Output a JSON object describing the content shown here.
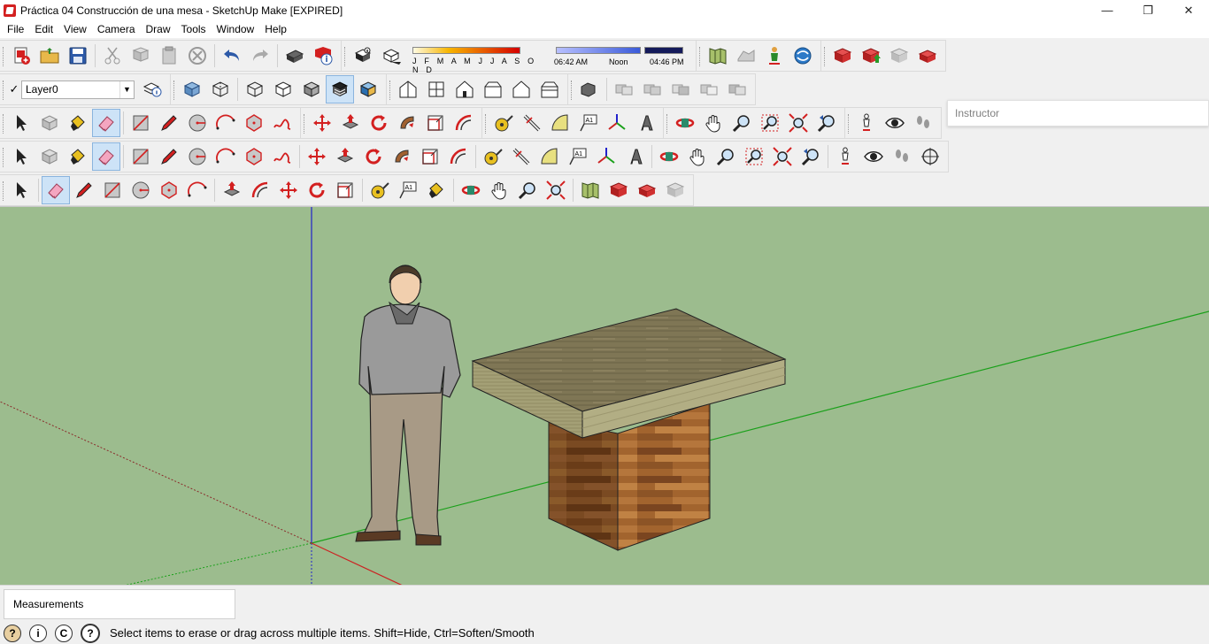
{
  "window": {
    "title": "Práctica 04 Construcción de una mesa - SketchUp Make [EXPIRED]",
    "minimize": "—",
    "restore": "❐",
    "close": "✕"
  },
  "menu": {
    "items": [
      "File",
      "Edit",
      "View",
      "Camera",
      "Draw",
      "Tools",
      "Window",
      "Help"
    ]
  },
  "shadows": {
    "months": "J F M A M J J A S O N D",
    "time_start": "06:42 AM",
    "time_mid": "Noon",
    "time_end": "04:46 PM"
  },
  "layers": {
    "current": "Layer0",
    "check": "✓",
    "arrow": "▼"
  },
  "instructor": {
    "label": "Instructor"
  },
  "measurements": {
    "label": "Measurements",
    "value": ""
  },
  "status": {
    "text": "Select items to erase or drag across multiple items. Shift=Hide, Ctrl=Soften/Smooth",
    "icon_geo": "?",
    "icon_credit": "i",
    "icon_copyright": "C",
    "icon_help": "?"
  },
  "colors": {
    "viewport_bg": "#9cbc8e",
    "axis_red": "#cc2222",
    "axis_green": "#1aa01a",
    "axis_blue": "#2222cc",
    "active_tool": "#cde3f7"
  }
}
